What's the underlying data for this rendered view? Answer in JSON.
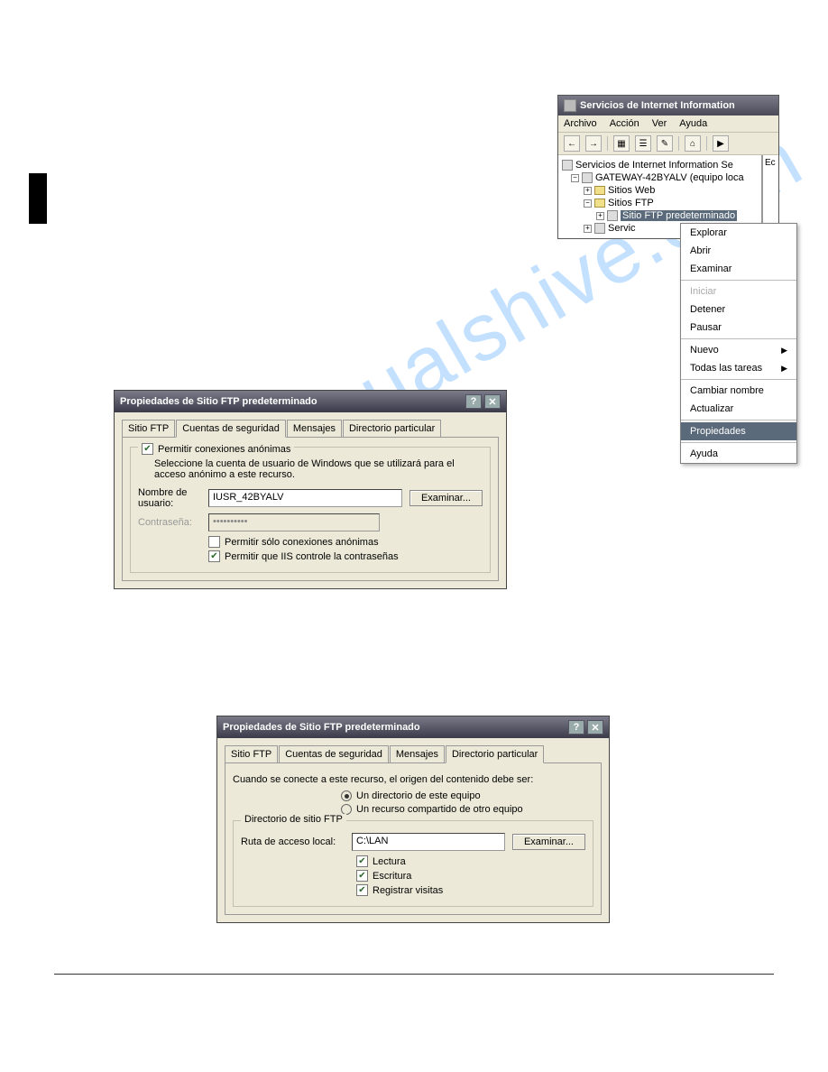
{
  "iis": {
    "title": "Servicios de Internet Information",
    "menu": [
      "Archivo",
      "Acción",
      "Ver",
      "Ayuda"
    ],
    "tree": {
      "root": "Servicios de Internet Information Se",
      "computer": "GATEWAY-42BYALV (equipo loca",
      "sitiosWeb": "Sitios Web",
      "sitiosFtp": "Sitios FTP",
      "ftpDefault": "Sitio FTP predeterminado",
      "servicio": "Servic"
    },
    "sideCol": "Ec"
  },
  "ctx": {
    "items": [
      {
        "label": "Explorar"
      },
      {
        "label": "Abrir"
      },
      {
        "label": "Examinar"
      },
      {
        "sep": true
      },
      {
        "label": "Iniciar",
        "disabled": true
      },
      {
        "label": "Detener"
      },
      {
        "label": "Pausar"
      },
      {
        "sep": true
      },
      {
        "label": "Nuevo",
        "sub": true
      },
      {
        "label": "Todas las tareas",
        "sub": true
      },
      {
        "sep": true
      },
      {
        "label": "Cambiar nombre"
      },
      {
        "label": "Actualizar"
      },
      {
        "sep": true
      },
      {
        "label": "Propiedades",
        "hi": true
      },
      {
        "sep": true
      },
      {
        "label": "Ayuda"
      }
    ]
  },
  "dlg1": {
    "title": "Propiedades de Sitio FTP predeterminado",
    "tabs": [
      "Sitio FTP",
      "Cuentas de seguridad",
      "Mensajes",
      "Directorio particular"
    ],
    "chkAllow": "Permitir conexiones anónimas",
    "info": "Seleccione la cuenta de usuario de Windows que se utilizará para el acceso anónimo a este recurso.",
    "lblUser": "Nombre de usuario:",
    "userVal": "IUSR_42BYALV",
    "lblPass": "Contraseña:",
    "passVal": "••••••••••",
    "btnBrowse": "Examinar...",
    "chkOnly": "Permitir sólo conexiones anónimas",
    "chkIIS": "Permitir que IIS controle la contraseñas"
  },
  "dlg2": {
    "title": "Propiedades de Sitio FTP predeterminado",
    "tabs": [
      "Sitio FTP",
      "Cuentas de seguridad",
      "Mensajes",
      "Directorio particular"
    ],
    "intro": "Cuando se conecte a este recurso, el origen del contenido debe ser:",
    "r1": "Un directorio de este equipo",
    "r2": "Un recurso compartido de otro equipo",
    "grpTitle": "Directorio de sitio FTP",
    "lblPath": "Ruta de acceso local:",
    "pathVal": "C:\\LAN",
    "btnBrowse": "Examinar...",
    "chkRead": "Lectura",
    "chkWrite": "Escritura",
    "chkLog": "Registrar visitas"
  }
}
